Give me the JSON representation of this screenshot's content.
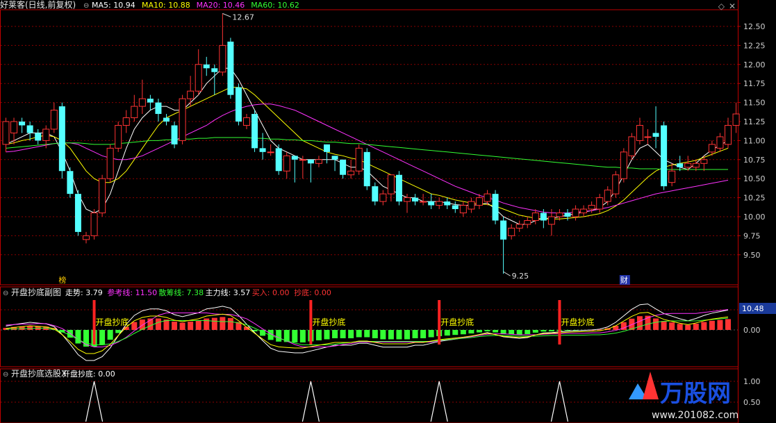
{
  "header": {
    "title": "好莱客(日线,前复权)",
    "ma_labels": [
      {
        "label": "MA5: 10.94",
        "color": "#ffffff"
      },
      {
        "label": "MA10: 10.88",
        "color": "#ffff00"
      },
      {
        "label": "MA20: 10.46",
        "color": "#ff33ff"
      },
      {
        "label": "MA60: 10.62",
        "color": "#33ff33"
      }
    ],
    "high_label": "12.67",
    "low_label": "9.25",
    "event_markers": [
      "榜",
      "财"
    ]
  },
  "price_axis": [
    "12.50",
    "12.25",
    "12.00",
    "11.75",
    "11.50",
    "11.25",
    "11.00",
    "10.75",
    "10.50",
    "10.25",
    "10.00",
    "9.75",
    "9.50"
  ],
  "sub1": {
    "title": "开盘抄底副图",
    "items": [
      {
        "label": "走势: 3.79",
        "color": "#ffffff"
      },
      {
        "label": "参考线: 11.50",
        "color": "#ff33ff"
      },
      {
        "label": "散筹线: 7.38",
        "color": "#33ff33"
      },
      {
        "label": "主力线: 3.57",
        "color": "#ffffff"
      },
      {
        "label": "买入: 0.00",
        "color": "#ff3333"
      },
      {
        "label": "抄底: 0.00",
        "color": "#ff3333"
      }
    ],
    "axis_value": "10.48",
    "zero_label": "0.00",
    "signal_label": "开盘抄底"
  },
  "sub2": {
    "title": "开盘抄底选股X",
    "items": [
      {
        "label": "开盘抄底: 0.00",
        "color": "#ffffff"
      }
    ],
    "axis": [
      "1.00",
      "0.50"
    ]
  },
  "watermark": {
    "brand": "万股网",
    "url": "www.201082.com"
  },
  "colors": {
    "up": "#ff3333",
    "down": "#54ffff",
    "grid": "#8b0000",
    "axis": "#c00000"
  },
  "chart_data": {
    "type": "candlestick",
    "ylim": [
      9.25,
      12.67
    ],
    "candles": [
      {
        "o": 10.95,
        "c": 11.25,
        "h": 11.3,
        "l": 10.85
      },
      {
        "o": 11.1,
        "c": 11.25,
        "h": 11.3,
        "l": 10.95
      },
      {
        "o": 11.25,
        "c": 11.2,
        "h": 11.3,
        "l": 11.1
      },
      {
        "o": 11.2,
        "c": 11.1,
        "h": 11.25,
        "l": 11.0
      },
      {
        "o": 11.1,
        "c": 11.0,
        "h": 11.15,
        "l": 10.95
      },
      {
        "o": 11.0,
        "c": 11.15,
        "h": 11.2,
        "l": 10.9
      },
      {
        "o": 11.15,
        "c": 11.4,
        "h": 11.5,
        "l": 11.1
      },
      {
        "o": 11.45,
        "c": 10.6,
        "h": 11.5,
        "l": 10.5
      },
      {
        "o": 10.6,
        "c": 10.3,
        "h": 10.65,
        "l": 10.25
      },
      {
        "o": 10.3,
        "c": 9.8,
        "h": 10.35,
        "l": 9.75
      },
      {
        "o": 9.7,
        "c": 9.75,
        "h": 9.8,
        "l": 9.65
      },
      {
        "o": 9.75,
        "c": 10.05,
        "h": 10.1,
        "l": 9.7
      },
      {
        "o": 10.05,
        "c": 10.5,
        "h": 10.55,
        "l": 10.0
      },
      {
        "o": 10.5,
        "c": 10.9,
        "h": 10.95,
        "l": 10.45
      },
      {
        "o": 10.9,
        "c": 11.2,
        "h": 11.25,
        "l": 10.85
      },
      {
        "o": 11.2,
        "c": 11.3,
        "h": 11.4,
        "l": 11.1
      },
      {
        "o": 11.3,
        "c": 11.45,
        "h": 11.6,
        "l": 11.25
      },
      {
        "o": 11.45,
        "c": 11.55,
        "h": 11.8,
        "l": 11.35
      },
      {
        "o": 11.55,
        "c": 11.5,
        "h": 11.6,
        "l": 11.4
      },
      {
        "o": 11.5,
        "c": 11.35,
        "h": 11.55,
        "l": 11.25
      },
      {
        "o": 11.3,
        "c": 11.25,
        "h": 11.35,
        "l": 11.2
      },
      {
        "o": 11.2,
        "c": 10.95,
        "h": 11.25,
        "l": 10.9
      },
      {
        "o": 11.0,
        "c": 11.55,
        "h": 11.6,
        "l": 10.95
      },
      {
        "o": 11.55,
        "c": 11.65,
        "h": 11.85,
        "l": 11.45
      },
      {
        "o": 11.65,
        "c": 12.0,
        "h": 12.2,
        "l": 11.6
      },
      {
        "o": 12.0,
        "c": 11.95,
        "h": 12.1,
        "l": 11.85
      },
      {
        "o": 11.95,
        "c": 11.9,
        "h": 12.0,
        "l": 11.6
      },
      {
        "o": 11.9,
        "c": 12.25,
        "h": 12.67,
        "l": 11.85
      },
      {
        "o": 12.3,
        "c": 11.6,
        "h": 12.35,
        "l": 11.55
      },
      {
        "o": 11.7,
        "c": 11.25,
        "h": 11.75,
        "l": 11.2
      },
      {
        "o": 11.2,
        "c": 11.3,
        "h": 11.35,
        "l": 11.15
      },
      {
        "o": 11.35,
        "c": 10.9,
        "h": 11.4,
        "l": 10.85
      },
      {
        "o": 10.9,
        "c": 10.85,
        "h": 11.1,
        "l": 10.75
      },
      {
        "o": 10.85,
        "c": 10.85,
        "h": 10.95,
        "l": 10.8
      },
      {
        "o": 10.9,
        "c": 10.6,
        "h": 10.95,
        "l": 10.55
      },
      {
        "o": 10.6,
        "c": 10.8,
        "h": 10.85,
        "l": 10.5
      },
      {
        "o": 10.8,
        "c": 10.75,
        "h": 10.8,
        "l": 10.45
      },
      {
        "o": 10.75,
        "c": 10.75,
        "h": 10.8,
        "l": 10.5
      },
      {
        "o": 10.75,
        "c": 10.7,
        "h": 10.75,
        "l": 10.45
      },
      {
        "o": 10.7,
        "c": 10.75,
        "h": 10.8,
        "l": 10.65
      },
      {
        "o": 10.95,
        "c": 10.85,
        "h": 10.95,
        "l": 10.7
      },
      {
        "o": 10.8,
        "c": 10.75,
        "h": 10.8,
        "l": 10.6
      },
      {
        "o": 10.75,
        "c": 10.55,
        "h": 10.75,
        "l": 10.5
      },
      {
        "o": 10.55,
        "c": 10.6,
        "h": 10.75,
        "l": 10.5
      },
      {
        "o": 10.6,
        "c": 10.9,
        "h": 10.95,
        "l": 10.55
      },
      {
        "o": 10.85,
        "c": 10.4,
        "h": 10.9,
        "l": 10.35
      },
      {
        "o": 10.4,
        "c": 10.2,
        "h": 10.45,
        "l": 10.15
      },
      {
        "o": 10.2,
        "c": 10.3,
        "h": 10.35,
        "l": 10.15
      },
      {
        "o": 10.3,
        "c": 10.55,
        "h": 10.55,
        "l": 10.2
      },
      {
        "o": 10.55,
        "c": 10.2,
        "h": 10.6,
        "l": 10.15
      },
      {
        "o": 10.2,
        "c": 10.25,
        "h": 10.3,
        "l": 10.05
      },
      {
        "o": 10.25,
        "c": 10.2,
        "h": 10.3,
        "l": 10.15
      },
      {
        "o": 10.2,
        "c": 10.2,
        "h": 10.3,
        "l": 10.15
      },
      {
        "o": 10.2,
        "c": 10.15,
        "h": 10.3,
        "l": 10.1
      },
      {
        "o": 10.15,
        "c": 10.2,
        "h": 10.25,
        "l": 10.1
      },
      {
        "o": 10.2,
        "c": 10.15,
        "h": 10.25,
        "l": 10.1
      },
      {
        "o": 10.15,
        "c": 10.1,
        "h": 10.2,
        "l": 10.05
      },
      {
        "o": 10.05,
        "c": 10.15,
        "h": 10.2,
        "l": 10.0
      },
      {
        "o": 10.1,
        "c": 10.2,
        "h": 10.25,
        "l": 10.05
      },
      {
        "o": 10.15,
        "c": 10.25,
        "h": 10.3,
        "l": 10.1
      },
      {
        "o": 10.2,
        "c": 10.3,
        "h": 10.35,
        "l": 10.15
      },
      {
        "o": 10.3,
        "c": 9.95,
        "h": 10.35,
        "l": 9.9
      },
      {
        "o": 9.95,
        "c": 9.7,
        "h": 10.0,
        "l": 9.25
      },
      {
        "o": 9.75,
        "c": 9.85,
        "h": 9.9,
        "l": 9.7
      },
      {
        "o": 9.85,
        "c": 9.9,
        "h": 9.95,
        "l": 9.8
      },
      {
        "o": 9.9,
        "c": 9.95,
        "h": 10.0,
        "l": 9.85
      },
      {
        "o": 9.95,
        "c": 10.05,
        "h": 10.1,
        "l": 9.9
      },
      {
        "o": 10.05,
        "c": 9.95,
        "h": 10.1,
        "l": 9.85
      },
      {
        "o": 9.9,
        "c": 10.0,
        "h": 10.1,
        "l": 9.75
      },
      {
        "o": 10.0,
        "c": 10.05,
        "h": 10.1,
        "l": 9.95
      },
      {
        "o": 10.05,
        "c": 10.0,
        "h": 10.1,
        "l": 9.95
      },
      {
        "o": 10.0,
        "c": 10.1,
        "h": 10.15,
        "l": 9.95
      },
      {
        "o": 10.05,
        "c": 10.1,
        "h": 10.15,
        "l": 10.0
      },
      {
        "o": 10.1,
        "c": 10.15,
        "h": 10.2,
        "l": 10.05
      },
      {
        "o": 10.1,
        "c": 10.25,
        "h": 10.3,
        "l": 10.05
      },
      {
        "o": 10.2,
        "c": 10.35,
        "h": 10.4,
        "l": 10.15
      },
      {
        "o": 10.3,
        "c": 10.55,
        "h": 10.6,
        "l": 10.25
      },
      {
        "o": 10.5,
        "c": 10.85,
        "h": 10.9,
        "l": 10.45
      },
      {
        "o": 10.8,
        "c": 11.05,
        "h": 11.1,
        "l": 10.75
      },
      {
        "o": 11.0,
        "c": 11.2,
        "h": 11.3,
        "l": 10.95
      },
      {
        "o": 11.05,
        "c": 11.05,
        "h": 11.15,
        "l": 10.95
      },
      {
        "o": 11.1,
        "c": 11.05,
        "h": 11.45,
        "l": 10.9
      },
      {
        "o": 11.2,
        "c": 10.4,
        "h": 11.25,
        "l": 10.35
      },
      {
        "o": 10.45,
        "c": 10.6,
        "h": 10.7,
        "l": 10.4
      },
      {
        "o": 10.7,
        "c": 10.65,
        "h": 10.8,
        "l": 10.6
      },
      {
        "o": 10.65,
        "c": 10.7,
        "h": 10.8,
        "l": 10.6
      },
      {
        "o": 10.65,
        "c": 10.7,
        "h": 10.75,
        "l": 10.6
      },
      {
        "o": 10.7,
        "c": 10.75,
        "h": 10.8,
        "l": 10.6
      },
      {
        "o": 10.85,
        "c": 10.95,
        "h": 11.0,
        "l": 10.8
      },
      {
        "o": 10.9,
        "c": 11.05,
        "h": 11.1,
        "l": 10.85
      },
      {
        "o": 10.95,
        "c": 11.2,
        "h": 11.3,
        "l": 10.9
      },
      {
        "o": 11.2,
        "c": 11.35,
        "h": 11.5,
        "l": 11.1
      }
    ],
    "ma": [
      {
        "name": "MA5",
        "color": "#ffffff",
        "values": [
          10.95,
          11.0,
          11.05,
          11.1,
          11.1,
          11.1,
          11.05,
          10.85,
          10.6,
          10.3,
          10.1,
          10.05,
          10.1,
          10.3,
          10.6,
          10.9,
          11.15,
          11.3,
          11.4,
          11.45,
          11.45,
          11.4,
          11.4,
          11.5,
          11.6,
          11.75,
          11.85,
          11.95,
          11.95,
          11.8,
          11.6,
          11.4,
          11.2,
          11.0,
          10.9,
          10.85,
          10.8,
          10.75,
          10.75,
          10.75,
          10.75,
          10.75,
          10.7,
          10.65,
          10.65,
          10.6,
          10.5,
          10.4,
          10.35,
          10.3,
          10.25,
          10.25,
          10.2,
          10.2,
          10.2,
          10.18,
          10.16,
          10.15,
          10.15,
          10.16,
          10.18,
          10.1,
          10.0,
          9.95,
          9.9,
          9.9,
          9.95,
          9.98,
          9.98,
          10.0,
          10.02,
          10.04,
          10.06,
          10.08,
          10.12,
          10.2,
          10.35,
          10.55,
          10.75,
          10.9,
          10.95,
          10.85,
          10.75,
          10.7,
          10.65,
          10.62,
          10.7,
          10.8,
          10.88,
          10.94,
          11.0
        ]
      },
      {
        "name": "MA10",
        "color": "#ffff00",
        "values": [
          10.95,
          10.97,
          11.0,
          11.02,
          11.05,
          11.07,
          11.05,
          11.0,
          10.9,
          10.75,
          10.6,
          10.5,
          10.45,
          10.45,
          10.5,
          10.6,
          10.75,
          10.9,
          11.05,
          11.2,
          11.3,
          11.35,
          11.4,
          11.45,
          11.5,
          11.55,
          11.6,
          11.65,
          11.7,
          11.7,
          11.68,
          11.6,
          11.5,
          11.4,
          11.3,
          11.2,
          11.1,
          11.0,
          10.95,
          10.9,
          10.85,
          10.82,
          10.8,
          10.77,
          10.75,
          10.7,
          10.65,
          10.6,
          10.55,
          10.5,
          10.45,
          10.4,
          10.35,
          10.3,
          10.28,
          10.25,
          10.22,
          10.2,
          10.18,
          10.17,
          10.16,
          10.14,
          10.1,
          10.06,
          10.02,
          10.0,
          9.98,
          9.97,
          9.97,
          9.97,
          9.98,
          9.99,
          10.0,
          10.02,
          10.04,
          10.08,
          10.14,
          10.22,
          10.32,
          10.42,
          10.52,
          10.6,
          10.65,
          10.68,
          10.7,
          10.72,
          10.74,
          10.78,
          10.82,
          10.86,
          10.9
        ]
      },
      {
        "name": "MA20",
        "color": "#ff33ff",
        "values": [
          10.85,
          10.86,
          10.88,
          10.9,
          10.92,
          10.94,
          10.96,
          10.97,
          10.97,
          10.95,
          10.9,
          10.85,
          10.8,
          10.77,
          10.75,
          10.75,
          10.77,
          10.8,
          10.85,
          10.9,
          10.95,
          11.0,
          11.05,
          11.1,
          11.15,
          11.2,
          11.27,
          11.33,
          11.38,
          11.42,
          11.45,
          11.47,
          11.48,
          11.48,
          11.46,
          11.43,
          11.4,
          11.35,
          11.3,
          11.25,
          11.2,
          11.15,
          11.1,
          11.05,
          11.0,
          10.95,
          10.9,
          10.85,
          10.8,
          10.75,
          10.7,
          10.65,
          10.6,
          10.55,
          10.5,
          10.45,
          10.4,
          10.36,
          10.32,
          10.28,
          10.25,
          10.22,
          10.18,
          10.15,
          10.12,
          10.1,
          10.08,
          10.06,
          10.05,
          10.05,
          10.05,
          10.06,
          10.07,
          10.08,
          10.1,
          10.12,
          10.15,
          10.18,
          10.21,
          10.24,
          10.27,
          10.3,
          10.32,
          10.34,
          10.36,
          10.38,
          10.4,
          10.42,
          10.44,
          10.46,
          10.48
        ]
      },
      {
        "name": "MA60",
        "color": "#33ff33",
        "values": [
          10.9,
          10.91,
          10.92,
          10.93,
          10.94,
          10.95,
          10.96,
          10.97,
          10.97,
          10.97,
          10.96,
          10.95,
          10.95,
          10.95,
          10.96,
          10.97,
          10.98,
          10.99,
          11.0,
          11.0,
          11.01,
          11.01,
          11.02,
          11.02,
          11.03,
          11.03,
          11.04,
          11.04,
          11.04,
          11.04,
          11.04,
          11.03,
          11.03,
          11.02,
          11.02,
          11.01,
          11.01,
          11.0,
          11.0,
          10.99,
          10.98,
          10.98,
          10.97,
          10.96,
          10.96,
          10.95,
          10.94,
          10.93,
          10.92,
          10.91,
          10.9,
          10.89,
          10.88,
          10.87,
          10.86,
          10.85,
          10.84,
          10.83,
          10.82,
          10.81,
          10.8,
          10.79,
          10.78,
          10.77,
          10.76,
          10.75,
          10.74,
          10.73,
          10.72,
          10.71,
          10.7,
          10.69,
          10.68,
          10.67,
          10.66,
          10.65,
          10.65,
          10.64,
          10.64,
          10.63,
          10.63,
          10.63,
          10.62,
          10.62,
          10.62,
          10.62,
          10.62,
          10.62,
          10.62,
          10.62,
          10.62
        ]
      }
    ],
    "signals": [
      11,
      38,
      54,
      69
    ]
  }
}
